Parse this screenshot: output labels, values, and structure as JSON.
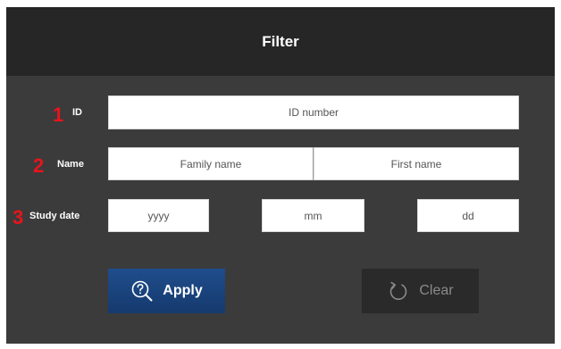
{
  "header": {
    "title": "Filter"
  },
  "rows": {
    "id": {
      "number": "1",
      "label": "ID",
      "placeholder": "ID number"
    },
    "name": {
      "number": "2",
      "label": "Name",
      "family_placeholder": "Family name",
      "first_placeholder": "First name"
    },
    "study_date": {
      "number": "3",
      "label": "Study date",
      "year_placeholder": "yyyy",
      "month_placeholder": "mm",
      "day_placeholder": "dd"
    }
  },
  "buttons": {
    "apply": {
      "label": "Apply",
      "icon": "search-help-icon"
    },
    "clear": {
      "label": "Clear",
      "icon": "undo-icon"
    }
  },
  "colors": {
    "header_bg": "#262626",
    "panel_bg": "#3b3b3b",
    "accent_number": "#e8141c",
    "apply_bg": "#1f4d8c",
    "clear_bg": "#2a2a2a"
  }
}
